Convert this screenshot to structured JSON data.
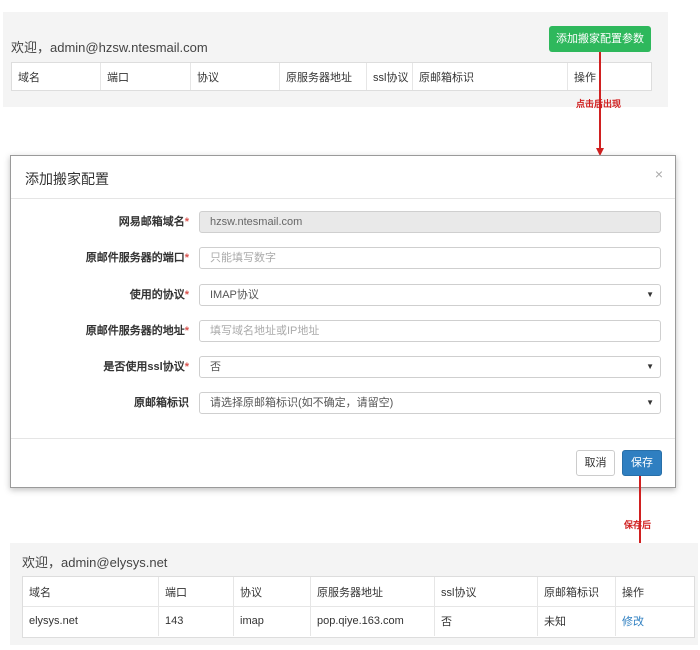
{
  "top_panel": {
    "welcome": "欢迎，admin@hzsw.ntesmail.com",
    "add_button": "添加搬家配置参数",
    "columns": [
      "域名",
      "端口",
      "协议",
      "原服务器地址",
      "ssl协议",
      "原邮箱标识",
      "操作"
    ]
  },
  "annotations": {
    "after_click": "点击后出现",
    "after_save": "保存后"
  },
  "modal": {
    "title": "添加搬家配置",
    "close": "×",
    "fields": [
      {
        "label": "网易邮箱域名",
        "required": "*",
        "value": "hzsw.ntesmail.com",
        "type": "disabled"
      },
      {
        "label": "原邮件服务器的端口",
        "required": "*",
        "placeholder": "只能填写数字",
        "type": "text"
      },
      {
        "label": "使用的协议",
        "required": "*",
        "value": "IMAP协议",
        "type": "select"
      },
      {
        "label": "原邮件服务器的地址",
        "required": "*",
        "placeholder": "填写域名地址或IP地址",
        "type": "text"
      },
      {
        "label": "是否使用ssl协议",
        "required": "*",
        "value": "否",
        "type": "select"
      },
      {
        "label": "原邮箱标识",
        "required": "",
        "value": "请选择原邮箱标识(如不确定，请留空)",
        "type": "select"
      }
    ],
    "cancel_label": "取消",
    "save_label": "保存"
  },
  "bottom_panel": {
    "welcome": "欢迎，admin@elysys.net",
    "columns": [
      "域名",
      "端口",
      "协议",
      "原服务器地址",
      "ssl协议",
      "原邮箱标识",
      "操作"
    ],
    "rows": [
      {
        "domain": "elysys.net",
        "port": "143",
        "protocol": "imap",
        "server": "pop.qiye.163.com",
        "ssl": "否",
        "mark": "未知",
        "action": "修改"
      }
    ]
  }
}
